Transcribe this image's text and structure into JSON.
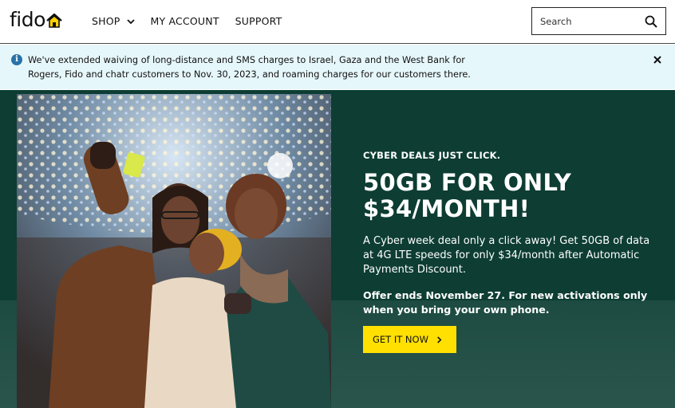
{
  "header": {
    "logo_text": "fido",
    "nav": [
      {
        "label": "SHOP",
        "has_dropdown": true
      },
      {
        "label": "MY ACCOUNT"
      },
      {
        "label": "SUPPORT"
      }
    ],
    "search": {
      "placeholder": "Search",
      "icon": "search-icon"
    }
  },
  "alert": {
    "icon": "info-icon",
    "text": "We've extended waiving of long-distance and SMS charges to Israel, Gaza and the West Bank for Rogers, Fido and chatr customers to Nov. 30, 2023, and roaming charges for our customers there.",
    "close_icon": "close-icon"
  },
  "hero": {
    "eyebrow": "CYBER DEALS JUST CLICK.",
    "headline": "50GB FOR ONLY $34/MONTH!",
    "body": "A Cyber week deal only a click away! Get 50GB of data at 4G LTE speeds for only $34/month after Automatic Payments Discount.",
    "offer": "Offer ends November 27. For new activations only when you bring your own phone.",
    "cta_label": "GET IT NOW",
    "colors": {
      "background": "#0d3d33",
      "cta": "#ffe000",
      "alert_bg": "#e6f7fb",
      "brand_yellow": "#ffd200"
    }
  }
}
